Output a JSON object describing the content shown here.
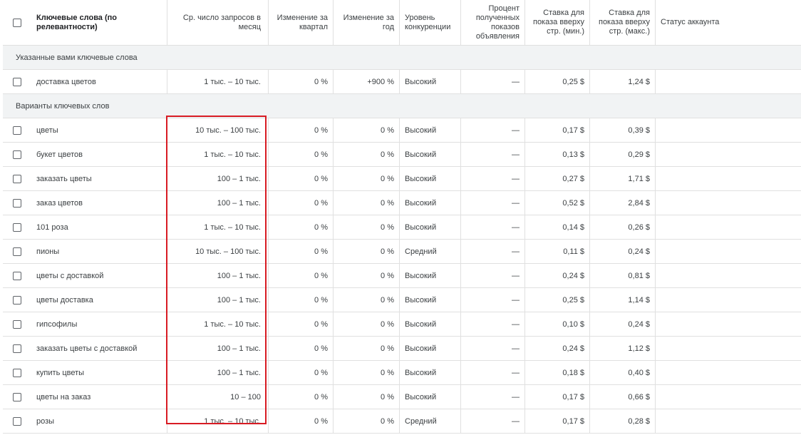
{
  "headers": {
    "keyword": "Ключевые слова (по релевантности)",
    "volume": "Ср. число запросов в месяц",
    "qtr_change": "Изменение за квартал",
    "yoy_change": "Изменение за год",
    "competition": "Уровень конкуренции",
    "impression_share": "Процент полученных показов объявления",
    "bid_low": "Ставка для показа вверху стр. (мин.)",
    "bid_high": "Ставка для показа вверху стр. (макс.)",
    "account_status": "Статус аккаунта"
  },
  "groups": {
    "provided": "Указанные вами ключевые слова",
    "ideas": "Варианты ключевых слов"
  },
  "provided_rows": [
    {
      "keyword": "доставка цветов",
      "volume": "1 тыс. – 10 тыс.",
      "qtr": "0 %",
      "yoy": "+900 %",
      "comp": "Высокий",
      "imp": "—",
      "bid_low": "0,25 $",
      "bid_high": "1,24 $",
      "status": ""
    }
  ],
  "idea_rows": [
    {
      "keyword": "цветы",
      "volume": "10 тыс. – 100 тыс.",
      "qtr": "0 %",
      "yoy": "0 %",
      "comp": "Высокий",
      "imp": "—",
      "bid_low": "0,17 $",
      "bid_high": "0,39 $",
      "status": ""
    },
    {
      "keyword": "букет цветов",
      "volume": "1 тыс. – 10 тыс.",
      "qtr": "0 %",
      "yoy": "0 %",
      "comp": "Высокий",
      "imp": "—",
      "bid_low": "0,13 $",
      "bid_high": "0,29 $",
      "status": ""
    },
    {
      "keyword": "заказать цветы",
      "volume": "100 – 1 тыс.",
      "qtr": "0 %",
      "yoy": "0 %",
      "comp": "Высокий",
      "imp": "—",
      "bid_low": "0,27 $",
      "bid_high": "1,71 $",
      "status": ""
    },
    {
      "keyword": "заказ цветов",
      "volume": "100 – 1 тыс.",
      "qtr": "0 %",
      "yoy": "0 %",
      "comp": "Высокий",
      "imp": "—",
      "bid_low": "0,52 $",
      "bid_high": "2,84 $",
      "status": ""
    },
    {
      "keyword": "101 роза",
      "volume": "1 тыс. – 10 тыс.",
      "qtr": "0 %",
      "yoy": "0 %",
      "comp": "Высокий",
      "imp": "—",
      "bid_low": "0,14 $",
      "bid_high": "0,26 $",
      "status": ""
    },
    {
      "keyword": "пионы",
      "volume": "10 тыс. – 100 тыс.",
      "qtr": "0 %",
      "yoy": "0 %",
      "comp": "Средний",
      "imp": "—",
      "bid_low": "0,11 $",
      "bid_high": "0,24 $",
      "status": ""
    },
    {
      "keyword": "цветы с доставкой",
      "volume": "100 – 1 тыс.",
      "qtr": "0 %",
      "yoy": "0 %",
      "comp": "Высокий",
      "imp": "—",
      "bid_low": "0,24 $",
      "bid_high": "0,81 $",
      "status": ""
    },
    {
      "keyword": "цветы доставка",
      "volume": "100 – 1 тыс.",
      "qtr": "0 %",
      "yoy": "0 %",
      "comp": "Высокий",
      "imp": "—",
      "bid_low": "0,25 $",
      "bid_high": "1,14 $",
      "status": ""
    },
    {
      "keyword": "гипсофилы",
      "volume": "1 тыс. – 10 тыс.",
      "qtr": "0 %",
      "yoy": "0 %",
      "comp": "Высокий",
      "imp": "—",
      "bid_low": "0,10 $",
      "bid_high": "0,24 $",
      "status": ""
    },
    {
      "keyword": "заказать цветы с доставкой",
      "volume": "100 – 1 тыс.",
      "qtr": "0 %",
      "yoy": "0 %",
      "comp": "Высокий",
      "imp": "—",
      "bid_low": "0,24 $",
      "bid_high": "1,12 $",
      "status": ""
    },
    {
      "keyword": "купить цветы",
      "volume": "100 – 1 тыс.",
      "qtr": "0 %",
      "yoy": "0 %",
      "comp": "Высокий",
      "imp": "—",
      "bid_low": "0,18 $",
      "bid_high": "0,40 $",
      "status": ""
    },
    {
      "keyword": "цветы на заказ",
      "volume": "10 – 100",
      "qtr": "0 %",
      "yoy": "0 %",
      "comp": "Высокий",
      "imp": "—",
      "bid_low": "0,17 $",
      "bid_high": "0,66 $",
      "status": ""
    },
    {
      "keyword": "розы",
      "volume": "1 тыс. – 10 тыс.",
      "qtr": "0 %",
      "yoy": "0 %",
      "comp": "Средний",
      "imp": "—",
      "bid_low": "0,17 $",
      "bid_high": "0,28 $",
      "status": ""
    }
  ],
  "colors": {
    "highlight_border": "#d81b23",
    "group_background": "#f1f3f4",
    "grid_line": "#e0e0e0"
  }
}
